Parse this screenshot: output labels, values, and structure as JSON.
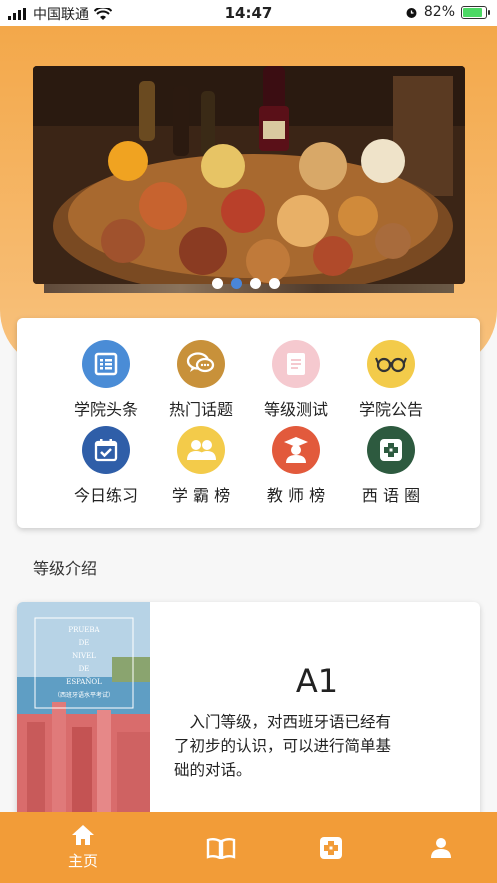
{
  "status_bar": {
    "carrier": "中国联通",
    "time": "14:47",
    "battery": "82%"
  },
  "banner": {
    "alt_theme": "spanish-tapas-food-photo",
    "slide_count": 4,
    "active_slide": 2
  },
  "menu": {
    "items": [
      {
        "label": "学院头条",
        "icon": "news-list-icon",
        "color": "#4a8cd6"
      },
      {
        "label": "热门话题",
        "icon": "chat-bubbles-icon",
        "color": "#c8913a"
      },
      {
        "label": "等级测试",
        "icon": "document-icon",
        "color": "#f5c9cf"
      },
      {
        "label": "学院公告",
        "icon": "glasses-icon",
        "color": "#f3cb4a"
      },
      {
        "label": "今日练习",
        "icon": "calendar-check-icon",
        "color": "#2f5ea8"
      },
      {
        "label": "学 霸 榜",
        "icon": "users-icon",
        "color": "#f3cb4a"
      },
      {
        "label": "教 师 榜",
        "icon": "teacher-icon",
        "color": "#e25a3c"
      },
      {
        "label": "西 语 圈",
        "icon": "circle-plus-icon",
        "color": "#2d5a3f"
      }
    ]
  },
  "section": {
    "title": "等级介绍"
  },
  "level": {
    "name": "A1",
    "description": "入门等级，对西班牙语已经有了初步的认识，可以进行简单基础的对话。",
    "image_lines": [
      "PRUEBA",
      "DE",
      "NIVEL",
      "DE",
      "ESPAÑOL",
      "（西班牙语水平考试）"
    ]
  },
  "tabbar": {
    "items": [
      {
        "label": "主页",
        "icon": "home-icon"
      },
      {
        "label": "",
        "icon": "book-icon"
      },
      {
        "label": "",
        "icon": "circle-plus-icon"
      },
      {
        "label": "",
        "icon": "user-icon"
      }
    ]
  }
}
